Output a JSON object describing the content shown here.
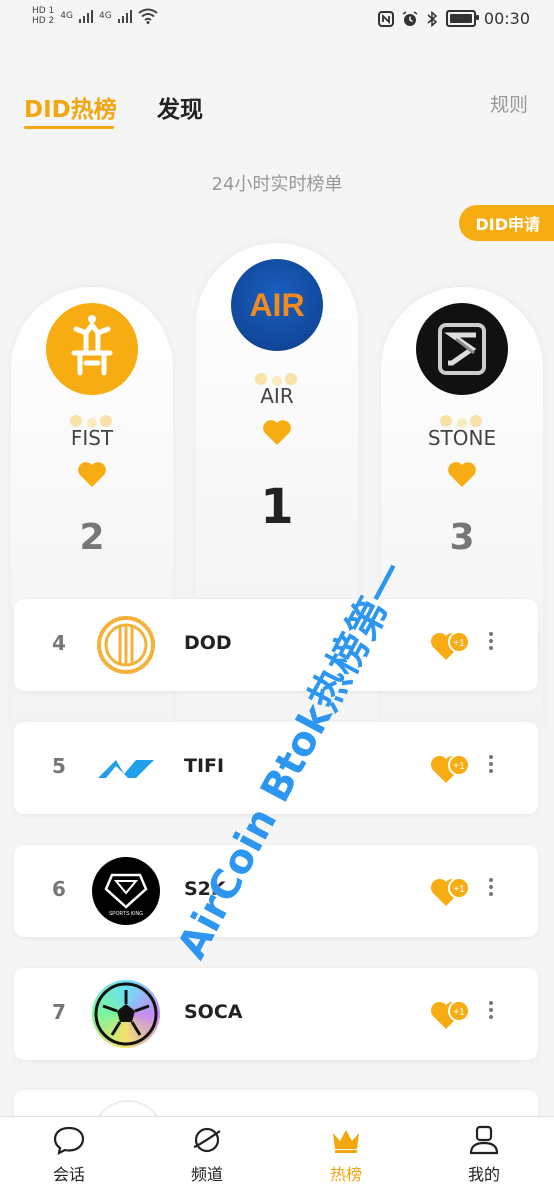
{
  "status_bar": {
    "sim1": "HD 1",
    "sim2": "HD 2",
    "net1": "4G",
    "net2": "4G",
    "time": "00:30"
  },
  "header": {
    "tab_active": "DID热榜",
    "tab_discover": "发现",
    "rules": "规则"
  },
  "subtitle": "24小时实时榜单",
  "did_apply": "DID申请",
  "podium": [
    {
      "rank": "1",
      "name": "AIR",
      "logo_text": "AIR"
    },
    {
      "rank": "2",
      "name": "FIST"
    },
    {
      "rank": "3",
      "name": "STONE"
    }
  ],
  "list": [
    {
      "rank": "4",
      "name": "DOD"
    },
    {
      "rank": "5",
      "name": "TIFI"
    },
    {
      "rank": "6",
      "name": "S2K",
      "logo_text": "SPORTS KING"
    },
    {
      "rank": "7",
      "name": "SOCA"
    }
  ],
  "like_badge": "+1",
  "watermark": "AirCoin Btok热榜第一",
  "bottom_nav": [
    {
      "label": "会话",
      "icon": "chat-icon"
    },
    {
      "label": "频道",
      "icon": "planet-icon"
    },
    {
      "label": "热榜",
      "icon": "crown-icon"
    },
    {
      "label": "我的",
      "icon": "user-icon"
    }
  ],
  "colors": {
    "accent": "#f2a60f",
    "watermark": "#2c96f0"
  }
}
